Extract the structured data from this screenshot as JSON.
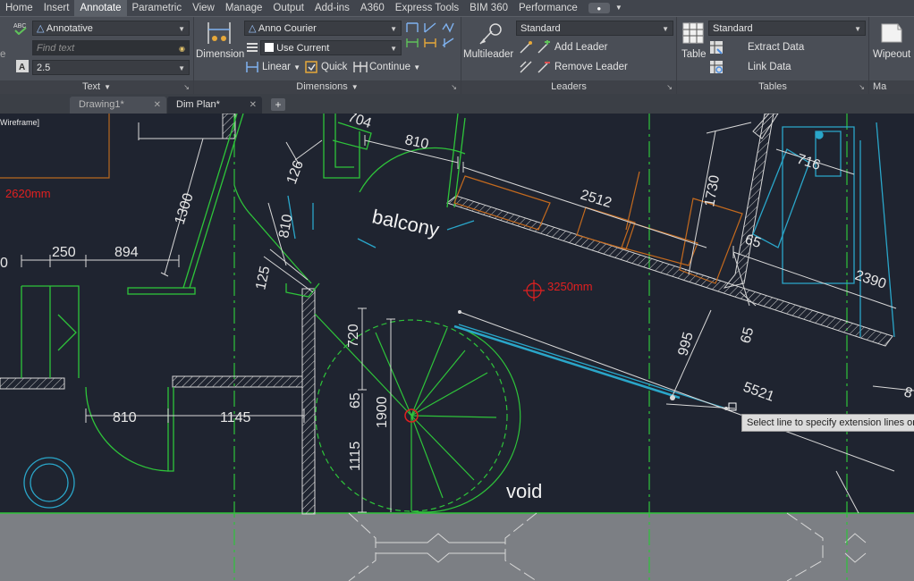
{
  "menubar": {
    "tabs": [
      "Home",
      "Insert",
      "Annotate",
      "Parametric",
      "View",
      "Manage",
      "Output",
      "Add-ins",
      "A360",
      "Express Tools",
      "BIM 360",
      "Performance"
    ],
    "active_index": 2
  },
  "ribbon": {
    "text": {
      "style": "Annotative",
      "find": "Find text",
      "height": "2.5",
      "title": "Text"
    },
    "dimensions": {
      "dimension_label": "Dimension",
      "style": "Anno Courier",
      "layer": "Use Current",
      "linear": "Linear",
      "quick": "Quick",
      "continue": "Continue",
      "title": "Dimensions"
    },
    "leaders": {
      "multileader_label": "Multileader",
      "style": "Standard",
      "add": "Add Leader",
      "remove": "Remove Leader",
      "title": "Leaders"
    },
    "tables": {
      "table_label": "Table",
      "style": "Standard",
      "extract": "Extract Data",
      "link": "Link Data",
      "title": "Tables"
    },
    "markup": {
      "wipeout_label": "Wipeout",
      "title": "Ma"
    }
  },
  "doc_tabs": {
    "tabs": [
      "Drawing1*",
      "Dim Plan*"
    ],
    "active_index": 1
  },
  "canvas": {
    "viewport_label": "Wireframe]",
    "dimension_values": [
      "704",
      "810",
      "126",
      "1730",
      "2512",
      "716",
      "1300",
      "810",
      "65",
      "2390",
      "250",
      "894",
      "125",
      "3250mm",
      "2620mm",
      "720",
      "995",
      "65",
      "5521",
      "810",
      "1145",
      "1900",
      "65",
      "1115",
      "0",
      "8"
    ],
    "room_labels": {
      "balcony": "balcony",
      "void": "void"
    },
    "red_dimensions": {
      "upper_left": "2620mm",
      "center": "3250mm"
    },
    "tooltip": "Select line to specify extension lines orig"
  }
}
